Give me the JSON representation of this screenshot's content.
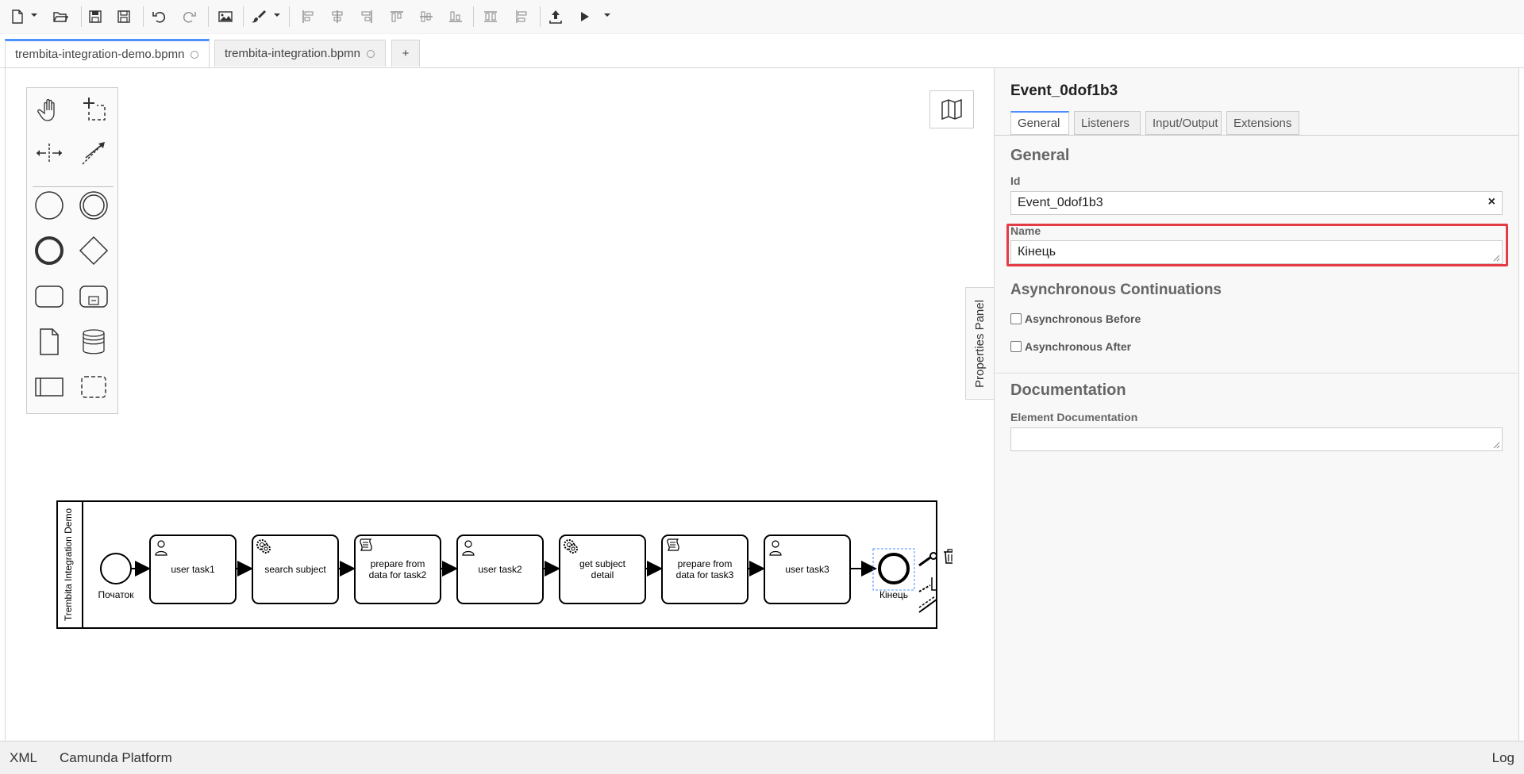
{
  "toolbar": {
    "buttons": [
      "new-file-icon",
      "open-file-icon",
      "save-icon",
      "save-as-icon",
      "undo-icon",
      "redo-icon",
      "export-image-icon",
      "color-brush-icon",
      "align-left-icon",
      "align-center-icon",
      "align-right-icon",
      "align-top-icon",
      "align-middle-icon",
      "align-bottom-icon",
      "distribute-horizontal-icon",
      "distribute-vertical-icon",
      "deploy-icon",
      "start-instance-icon"
    ]
  },
  "tabs": [
    {
      "label": "trembita-integration-demo.bpmn",
      "active": true
    },
    {
      "label": "trembita-integration.bpmn",
      "active": false
    }
  ],
  "add_tab_label": "+",
  "properties_toggle_label": "Properties Panel",
  "properties": {
    "title": "Event_0dof1b3",
    "tabs": [
      "General",
      "Listeners",
      "Input/Output",
      "Extensions"
    ],
    "general_heading": "General",
    "id_label": "Id",
    "id_value": "Event_0dof1b3",
    "clear_symbol": "×",
    "name_label": "Name",
    "name_value": "Кінець",
    "async_heading": "Asynchronous Continuations",
    "async_before_label": "Asynchronous Before",
    "async_after_label": "Asynchronous After",
    "documentation_heading": "Documentation",
    "element_documentation_label": "Element Documentation",
    "element_documentation_value": ""
  },
  "diagram": {
    "pool_name": "Trembita Integration Demo",
    "start_event_label": "Початок",
    "end_event_label": "Кінець",
    "tasks": [
      {
        "type": "user",
        "lines": [
          "user task1"
        ]
      },
      {
        "type": "service",
        "lines": [
          "search subject"
        ]
      },
      {
        "type": "script",
        "lines": [
          "prepare from",
          "data for task2"
        ]
      },
      {
        "type": "user",
        "lines": [
          "user task2"
        ]
      },
      {
        "type": "service",
        "lines": [
          "get subject",
          "detail"
        ]
      },
      {
        "type": "script",
        "lines": [
          "prepare from",
          "data for task3"
        ]
      },
      {
        "type": "user",
        "lines": [
          "user task3"
        ]
      }
    ]
  },
  "statusbar": {
    "xml_label": "XML",
    "platform_label": "Camunda Platform",
    "log_label": "Log"
  }
}
